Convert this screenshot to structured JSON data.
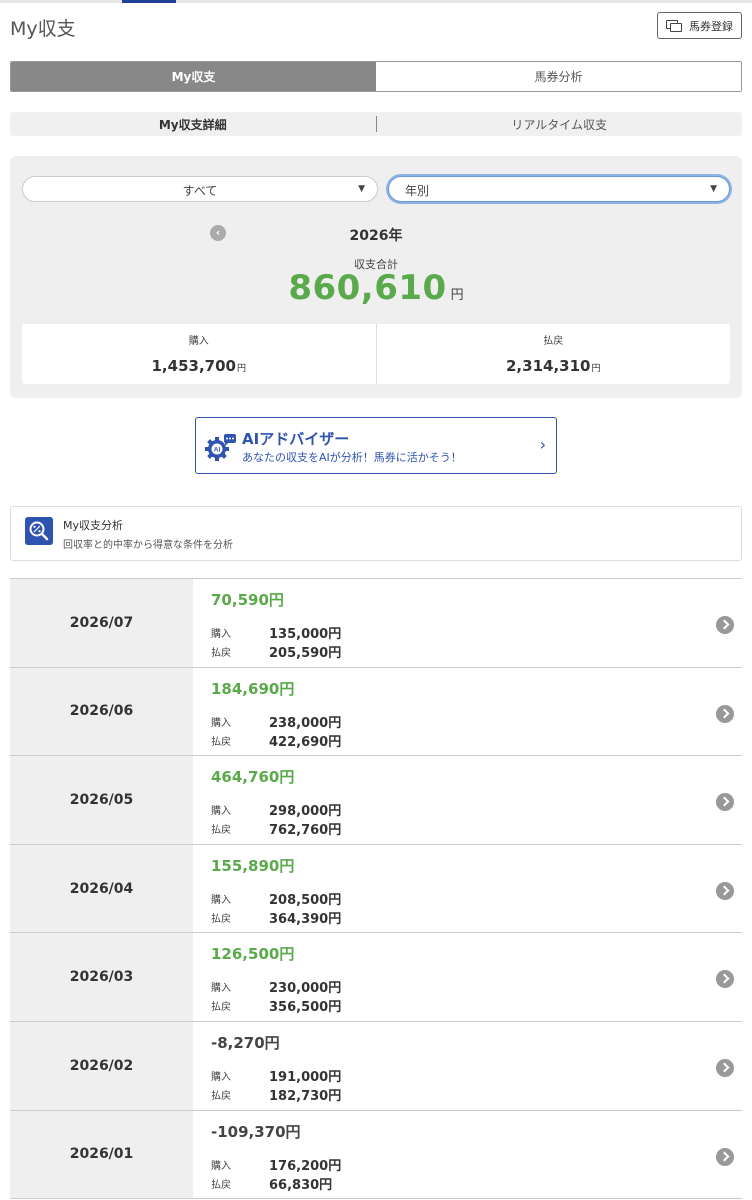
{
  "header": {
    "title": "My収支",
    "register_label": "馬券登録"
  },
  "main_tabs": [
    {
      "label": "My収支",
      "active": true
    },
    {
      "label": "馬券分析",
      "active": false
    }
  ],
  "sub_tabs": [
    {
      "label": "My収支詳細",
      "active": true
    },
    {
      "label": "リアルタイム収支",
      "active": false
    }
  ],
  "filters": {
    "category": "すべて",
    "period": "年別"
  },
  "summary": {
    "year": "2026年",
    "total_label": "収支合計",
    "total_value": "860,610",
    "unit": "円",
    "purchase_label": "購入",
    "purchase_value": "1,453,700",
    "payout_label": "払戻",
    "payout_value": "2,314,310"
  },
  "ai_banner": {
    "title": "AIアドバイザー",
    "subtitle": "あなたの収支をAIが分析！馬券に活かそう！"
  },
  "analysis": {
    "title": "My収支分析",
    "subtitle": "回収率と的中率から得意な条件を分析"
  },
  "months": [
    {
      "date": "2026/07",
      "net": "70,590円",
      "positive": true,
      "purchase_label": "購入",
      "purchase": "135,000円",
      "payout_label": "払戻",
      "payout": "205,590円"
    },
    {
      "date": "2026/06",
      "net": "184,690円",
      "positive": true,
      "purchase_label": "購入",
      "purchase": "238,000円",
      "payout_label": "払戻",
      "payout": "422,690円"
    },
    {
      "date": "2026/05",
      "net": "464,760円",
      "positive": true,
      "purchase_label": "購入",
      "purchase": "298,000円",
      "payout_label": "払戻",
      "payout": "762,760円"
    },
    {
      "date": "2026/04",
      "net": "155,890円",
      "positive": true,
      "purchase_label": "購入",
      "purchase": "208,500円",
      "payout_label": "払戻",
      "payout": "364,390円"
    },
    {
      "date": "2026/03",
      "net": "126,500円",
      "positive": true,
      "purchase_label": "購入",
      "purchase": "230,000円",
      "payout_label": "払戻",
      "payout": "356,500円"
    },
    {
      "date": "2026/02",
      "net": "-8,270円",
      "positive": false,
      "purchase_label": "購入",
      "purchase": "191,000円",
      "payout_label": "払戻",
      "payout": "182,730円"
    },
    {
      "date": "2026/01",
      "net": "-109,370円",
      "positive": false,
      "purchase_label": "購入",
      "purchase": "176,200円",
      "payout_label": "払戻",
      "payout": "66,830円"
    }
  ],
  "colors": {
    "positive": "#5aaa4c",
    "accent": "#2f53b0",
    "tab_active": "#888888"
  }
}
